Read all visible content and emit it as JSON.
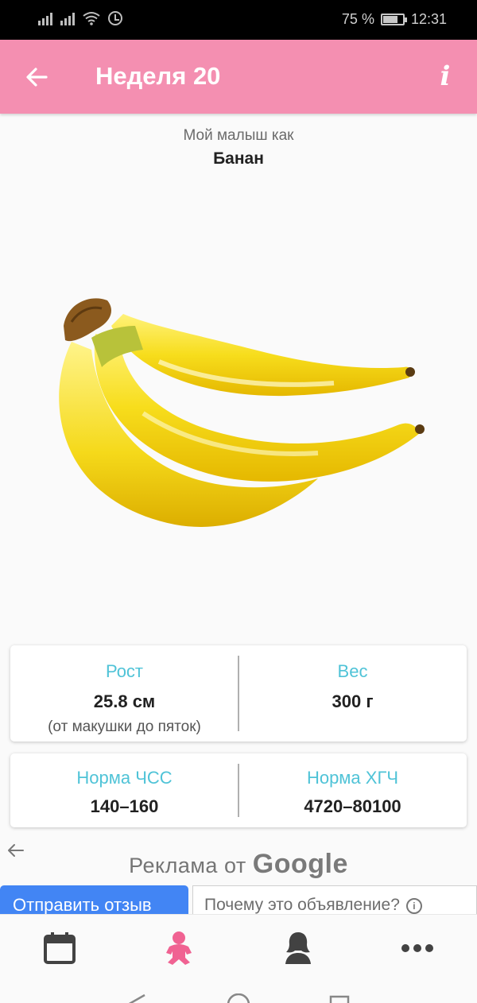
{
  "status_bar": {
    "battery": "75 %",
    "time": "12:31",
    "battery_level": 0.75
  },
  "app_bar": {
    "title": "Неделя 20",
    "back_icon": "arrow-left-icon",
    "info_icon": "info-icon",
    "info_label": "i",
    "color": "#f48fb1"
  },
  "fruit": {
    "subtitle": "Мой малыш как",
    "name": "Банан",
    "image_icon": "banana-image"
  },
  "size_card": {
    "length_label": "Рост",
    "length_value": "25.8 см",
    "length_note": "(от макушки до пяток)",
    "weight_label": "Вес",
    "weight_value": "300 г"
  },
  "norms_card": {
    "hr_label": "Норма ЧСС",
    "hr_value": "140–160",
    "hcg_label": "Норма ХГЧ",
    "hcg_value": "4720–80100"
  },
  "ad": {
    "label_prefix": "Реклама от",
    "brand": "Google",
    "send_feedback": "Отправить отзыв",
    "why_this_ad": "Почему это объявление?",
    "info_symbol": "i"
  },
  "bottom_nav": {
    "items": [
      {
        "icon": "calendar-icon",
        "active": false
      },
      {
        "icon": "baby-icon",
        "active": true
      },
      {
        "icon": "mother-icon",
        "active": false
      },
      {
        "icon": "more-icon",
        "active": false
      }
    ],
    "active_color": "#f06292",
    "inactive_color": "#424242"
  },
  "label_color": "#4fc3d7"
}
